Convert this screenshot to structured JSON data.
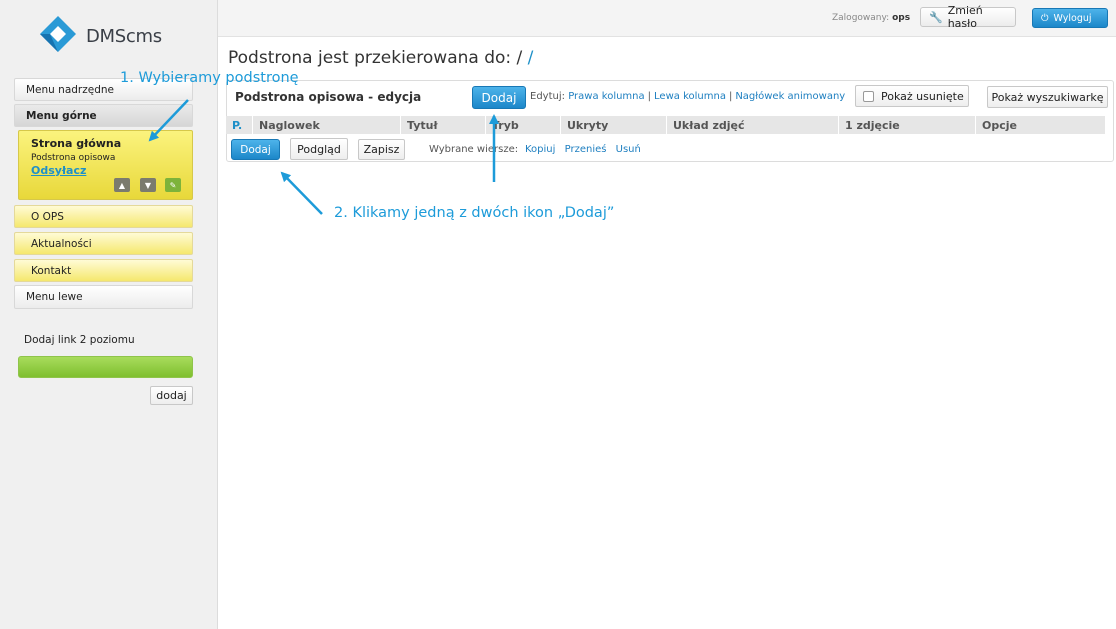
{
  "brand": {
    "name": "DMScms"
  },
  "sidebar": {
    "menu_parent": "Menu nadrzędne",
    "menu_top": "Menu górne",
    "selected": {
      "title": "Strona główna",
      "subtitle": "Podstrona opisowa",
      "link": "Odsyłacz"
    },
    "items": [
      "O OPS",
      "Aktualności",
      "Kontakt"
    ],
    "menu_left": "Menu lewe",
    "add_level2_label": "Dodaj link 2 poziomu",
    "add_button": "dodaj"
  },
  "topbar": {
    "logged_label": "Zalogowany:",
    "logged_user": "ops",
    "change_password": "Zmień hasło",
    "logout": "Wyloguj"
  },
  "main": {
    "title_prefix": "Podstrona jest przekierowana do:",
    "title_path1": "/",
    "title_path2": "/",
    "panel_title": "Podstrona opisowa - edycja",
    "add_button": "Dodaj",
    "edit_label": "Edytuj:",
    "edit_links": [
      "Prawa kolumna",
      "Lewa kolumna",
      "Nagłówek animowany"
    ],
    "show_deleted": "Pokaż usunięte",
    "show_search": "Pokaż wyszukiwarkę",
    "columns": [
      "P.",
      "Naglowek",
      "Tytuł",
      "Tryb",
      "Ukryty",
      "Układ zdjęć",
      "1 zdjęcie",
      "Opcje"
    ],
    "row_add": "Dodaj",
    "row_preview": "Podgląd",
    "row_save": "Zapisz",
    "selected_rows_label": "Wybrane wiersze:",
    "selected_actions": [
      "Kopiuj",
      "Przenieś",
      "Usuń"
    ]
  },
  "annotations": {
    "step1": "1. Wybieramy podstronę",
    "step2": "2. Klikamy jedną z dwóch ikon „Dodaj”"
  },
  "colors": {
    "accent": "#1e90c8",
    "annotation": "#1d9bd9",
    "selected_bg": "#f5e86e",
    "green_bar": "#8fcc3f"
  }
}
